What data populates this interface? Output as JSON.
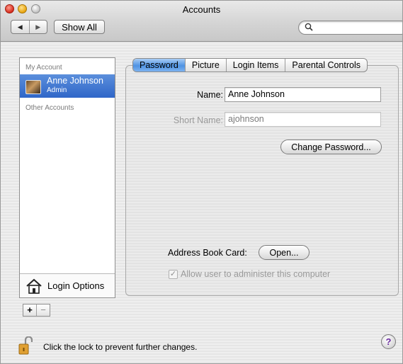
{
  "window": {
    "title": "Accounts"
  },
  "toolbar": {
    "back_icon": "◀",
    "forward_icon": "▶",
    "show_all_label": "Show All",
    "search_value": "",
    "search_icon": "magnifier-icon"
  },
  "sidebar": {
    "my_account_heading": "My Account",
    "current_account": {
      "name": "Anne Johnson",
      "role": "Admin"
    },
    "other_accounts_heading": "Other Accounts",
    "login_options_label": "Login Options",
    "add_label": "+",
    "remove_label": "−"
  },
  "tabs": [
    {
      "label": "Password",
      "active": true
    },
    {
      "label": "Picture",
      "active": false
    },
    {
      "label": "Login Items",
      "active": false
    },
    {
      "label": "Parental Controls",
      "active": false
    }
  ],
  "form": {
    "name_label": "Name:",
    "name_value": "Anne Johnson",
    "short_name_label": "Short Name:",
    "short_name_value": "ajohnson",
    "change_password_label": "Change Password...",
    "address_book_label": "Address Book Card:",
    "open_label": "Open...",
    "admin_checkbox_label": "Allow user to administer this computer",
    "admin_checkbox_checked": true,
    "check_mark": "✓"
  },
  "footer": {
    "lock_text": "Click the lock to prevent further changes.",
    "help_label": "?"
  },
  "colors": {
    "selection": "#3a70cf",
    "active_tab": "#5b9be6",
    "disabled_text": "#9a9a9a"
  }
}
